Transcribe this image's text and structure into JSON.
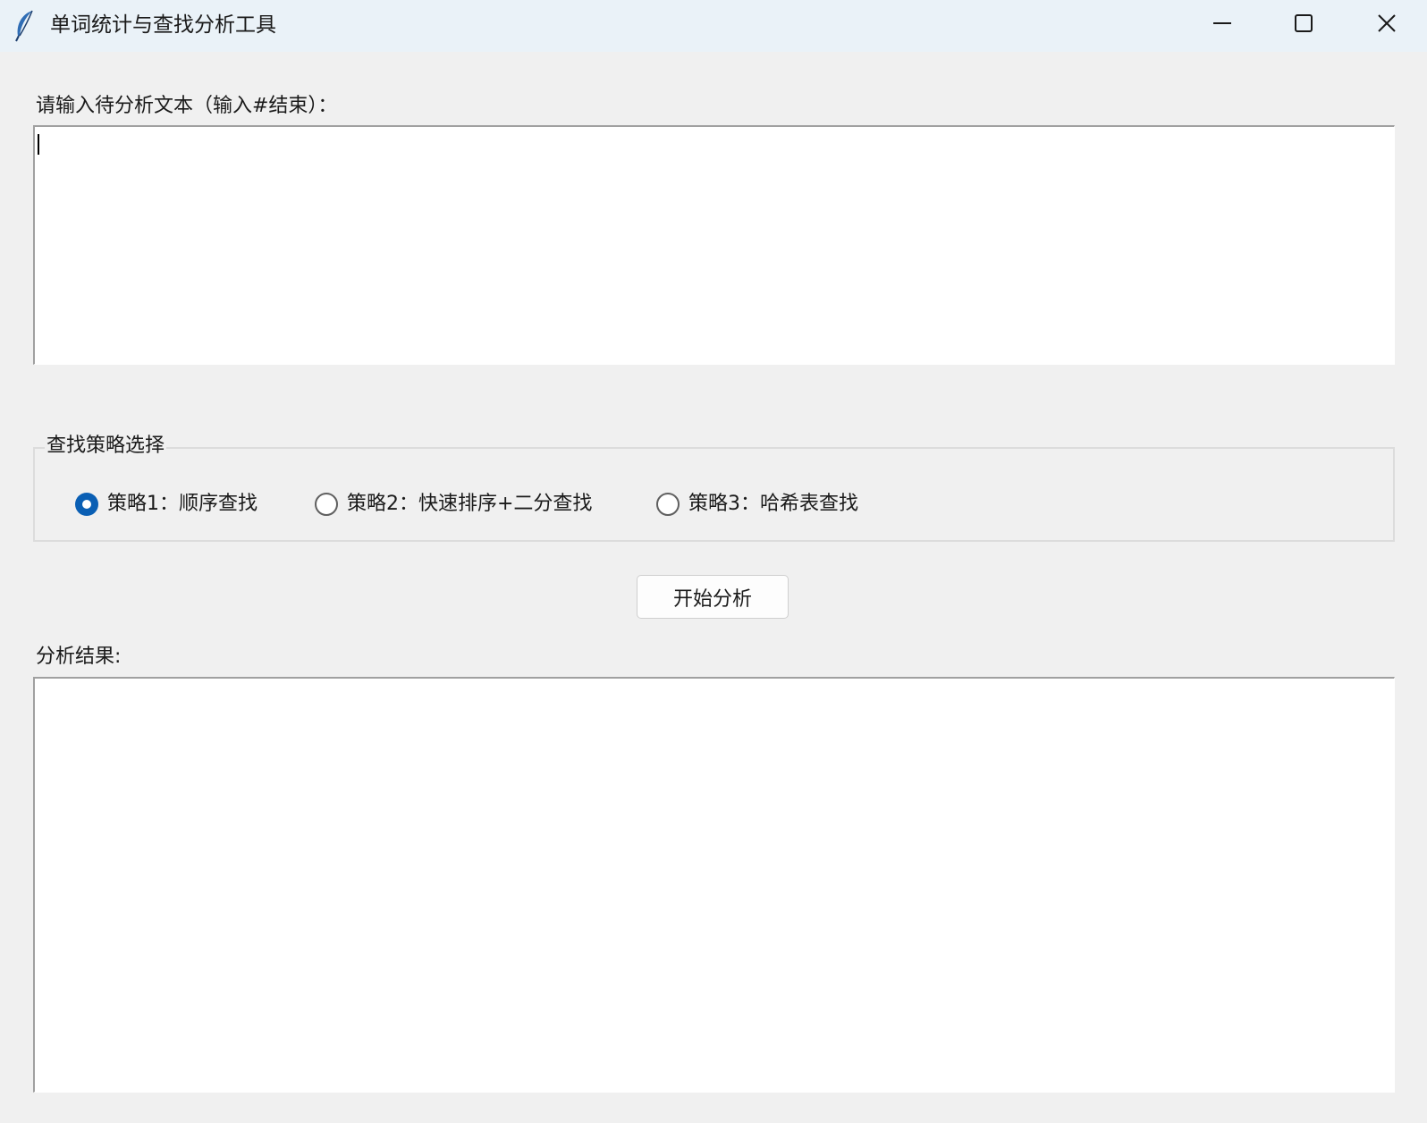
{
  "window": {
    "title": "单词统计与查找分析工具",
    "icon": "feather-icon",
    "controls": [
      "minimize-icon",
      "maximize-icon",
      "close-icon"
    ]
  },
  "input": {
    "label": "请输入待分析文本（输入#结束）：",
    "value": ""
  },
  "strategy": {
    "group_title": "查找策略选择",
    "options": [
      {
        "label": "策略1：顺序查找",
        "checked": true
      },
      {
        "label": "策略2：快速排序+二分查找",
        "checked": false
      },
      {
        "label": "策略3：哈希表查找",
        "checked": false
      }
    ]
  },
  "actions": {
    "start_label": "开始分析"
  },
  "result": {
    "label": "分析结果:",
    "value": ""
  },
  "colors": {
    "titlebar": "#eaf2f8",
    "background": "#f0f0f0",
    "radio_selected": "#0a5fb4"
  }
}
